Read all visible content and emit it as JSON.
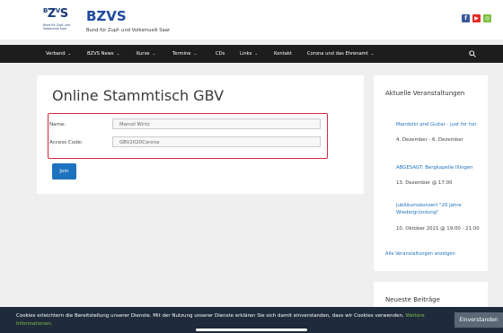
{
  "header": {
    "logo_main": "BZVS",
    "logo_sub": "Bund für Zupf- und Volksmusik Saar",
    "brand_title": "BZVS",
    "brand_tagline": "Bund für Zupf- und Volksmusik Saar",
    "social_icons": [
      "facebook-icon",
      "youtube-icon",
      "instagram-icon"
    ]
  },
  "nav": {
    "items": [
      {
        "label": "Verband",
        "dropdown": true
      },
      {
        "label": "BZVS News",
        "dropdown": true
      },
      {
        "label": "Kurse",
        "dropdown": true
      },
      {
        "label": "Termine",
        "dropdown": true
      },
      {
        "label": "CDs",
        "dropdown": false
      },
      {
        "label": "Links",
        "dropdown": true
      },
      {
        "label": "Kontakt",
        "dropdown": false
      },
      {
        "label": "Corona und das Ehrenamt",
        "dropdown": true
      }
    ],
    "search_icon": "search-icon"
  },
  "main": {
    "title": "Online Stammtisch GBV",
    "name_label": "Name:",
    "name_value": "Marcel Wirtz",
    "code_label": "Access Code:",
    "code_value": "GBV2020Corona",
    "join_label": "Join"
  },
  "sidebar": {
    "heading": "Aktuelle Veranstaltungen",
    "events": [
      {
        "title": "Mandolin and Guitar - just for fun",
        "date": "4. Dezember - 6. Dezember"
      },
      {
        "title": "ABGESAGT: Bergkapelle Illingen",
        "date": "13. Dezember @ 17:00"
      },
      {
        "title": "Jubiläumskonzert \"20 Jahre Wiedergründung\"",
        "date": "10. Oktober 2021 @ 19:00 - 21:00"
      }
    ],
    "all_events": "Alle Veranstaltungen anzeigen",
    "heading2": "Neueste Beiträge"
  },
  "cookie": {
    "text": "Cookies erleichtern die Bereitstellung unserer Dienste. Mit der Nutzung unserer Dienste erklären Sie sich damit einverstanden, dass wir Cookies verwenden.",
    "link": "Weitere Informationen.",
    "button": "Einverstanden"
  },
  "colors": {
    "accent": "#1e73be",
    "highlight": "#d7263d",
    "nav_bg": "#1d1d1d",
    "cookie_bg": "#1f2b3a"
  }
}
